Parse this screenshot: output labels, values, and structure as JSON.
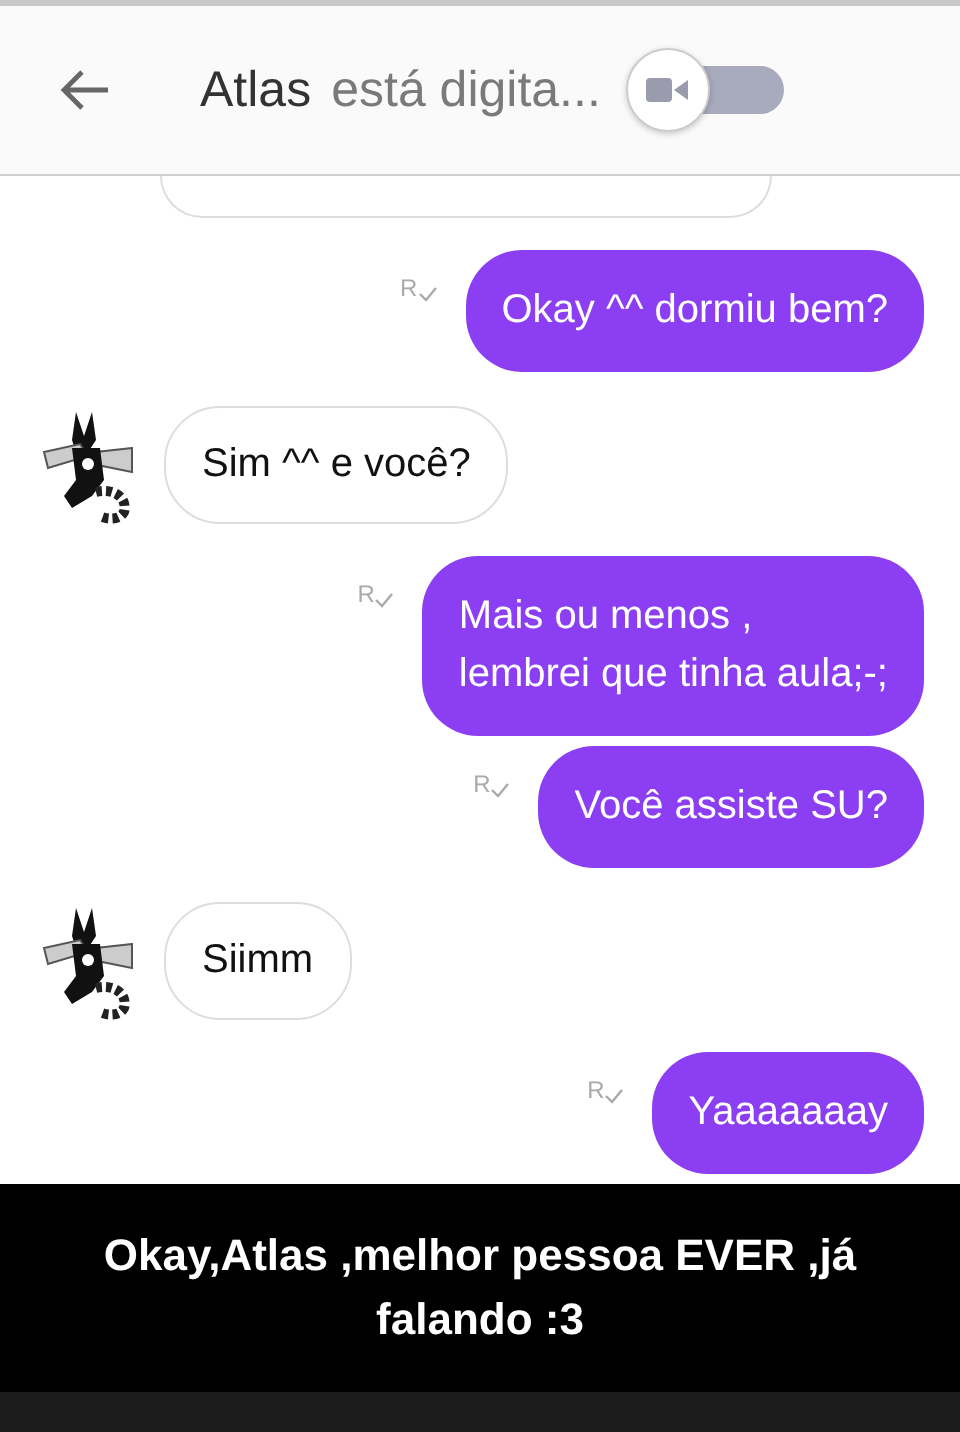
{
  "header": {
    "title": "Atlas",
    "status": "está digita...",
    "video_toggle": {
      "on": false
    }
  },
  "messages": [
    {
      "kind": "partial"
    },
    {
      "kind": "sent",
      "text": "Okay ^^ dormiu bem?",
      "receipt": "R"
    },
    {
      "kind": "received",
      "text": "Sim ^^ e você?"
    },
    {
      "kind": "sent",
      "text": "Mais ou menos ,\nlembrei que tinha aula;-;",
      "receipt": "R"
    },
    {
      "kind": "sent",
      "text": "Você assiste SU?",
      "receipt": "R"
    },
    {
      "kind": "received",
      "text": "Siimm"
    },
    {
      "kind": "sent",
      "text": "Yaaaaaaay",
      "receipt": "R"
    }
  ],
  "caption": "Okay,Atlas ,melhor pessoa EVER ,já falando :3"
}
